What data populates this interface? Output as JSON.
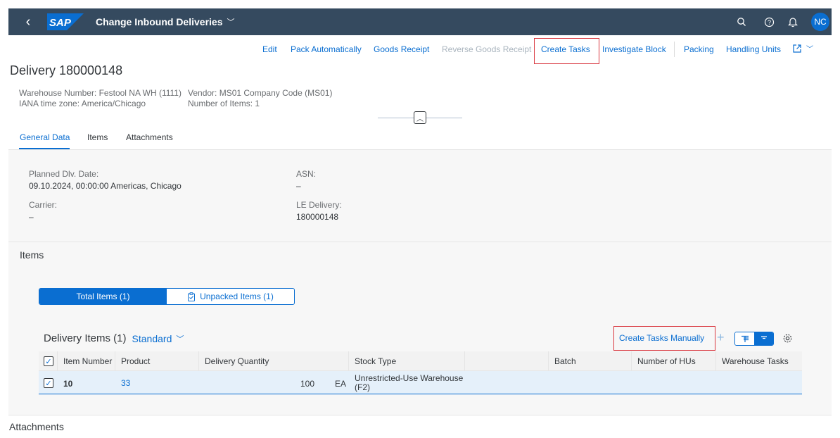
{
  "shell": {
    "logo_text": "SAP",
    "app_title": "Change Inbound Deliveries",
    "avatar_initials": "NC",
    "colors": {
      "shell_bg": "#354a5f",
      "accent": "#0a6ed1"
    }
  },
  "header": {
    "object_title": "Delivery 180000148",
    "actions": [
      {
        "label": "Edit",
        "enabled": true
      },
      {
        "label": "Pack Automatically",
        "enabled": true
      },
      {
        "label": "Goods Receipt",
        "enabled": true
      },
      {
        "label": "Reverse Goods Receipt",
        "enabled": false
      },
      {
        "label": "Create Tasks",
        "enabled": true,
        "highlighted": true
      },
      {
        "label": "Investigate Block",
        "enabled": true
      },
      {
        "label": "Packing",
        "enabled": true
      },
      {
        "label": "Handling Units",
        "enabled": true
      }
    ],
    "info": {
      "warehouse": "Warehouse Number: Festool NA WH (1111)",
      "timezone": "IANA time zone: America/Chicago",
      "vendor": "Vendor: MS01 Company Code (MS01)",
      "items_count": "Number of Items: 1"
    },
    "tabs": [
      {
        "label": "General Data",
        "active": true
      },
      {
        "label": "Items",
        "active": false
      },
      {
        "label": "Attachments",
        "active": false
      }
    ]
  },
  "general_data": {
    "planned_dlv_label": "Planned Dlv. Date:",
    "planned_dlv_value": "09.10.2024, 00:00:00 Americas, Chicago",
    "carrier_label": "Carrier:",
    "carrier_value": "–",
    "asn_label": "ASN:",
    "asn_value": "–",
    "le_delivery_label": "LE Delivery:",
    "le_delivery_value": "180000148"
  },
  "items": {
    "section_title": "Items",
    "segments": [
      {
        "label": "Total Items (1)",
        "active": true
      },
      {
        "label": "Unpacked Items (1)",
        "active": false
      }
    ],
    "table_title": "Delivery Items (1)",
    "variant": "Standard",
    "create_tasks_manually": "Create Tasks Manually",
    "columns": [
      "Item Number",
      "Product",
      "Delivery Quantity",
      "Stock Type",
      "Batch",
      "Number of HUs",
      "Warehouse Tasks"
    ],
    "rows": [
      {
        "item_number": "10",
        "product": "33",
        "quantity": "100",
        "unit": "EA",
        "stock_type_line1": "Unrestricted-Use Warehouse",
        "stock_type_line2": "(F2)",
        "selected": true
      }
    ]
  },
  "attachments": {
    "section_title": "Attachments"
  }
}
